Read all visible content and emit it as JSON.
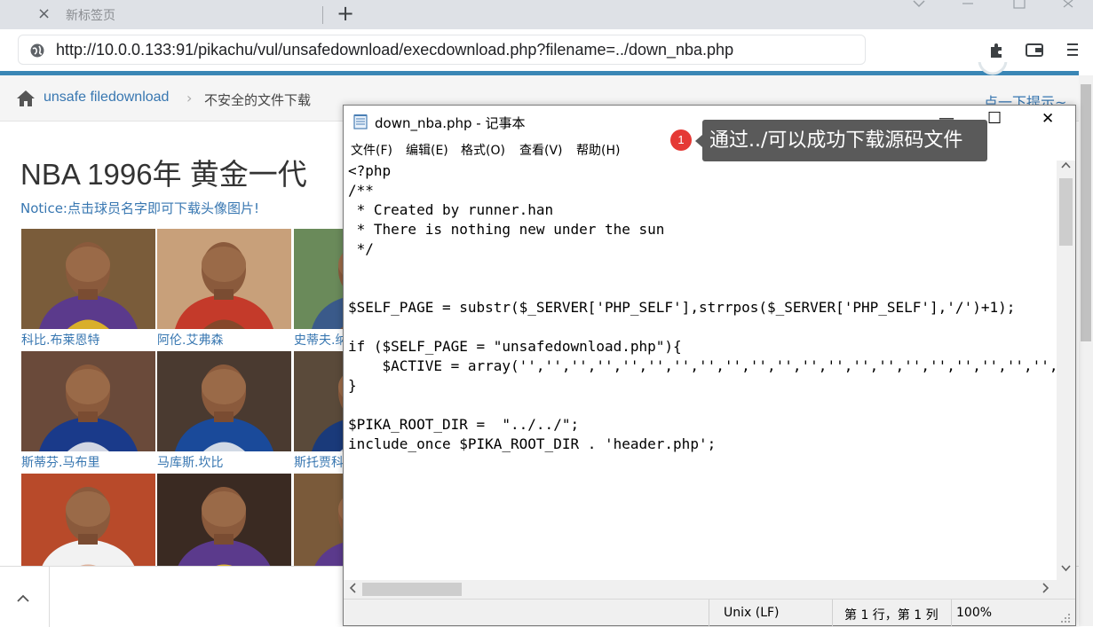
{
  "browser": {
    "tab_title": "新标签页",
    "tab_close": "×",
    "new_tab": "+",
    "url": "http://10.0.0.133:91/pikachu/vul/unsafedownload/execdownload.php?filename=../down_nba.php"
  },
  "page": {
    "breadcrumb_link": "unsafe filedownload",
    "breadcrumb_sep": "›",
    "breadcrumb_current": "不安全的文件下载",
    "hint": "点一下提示~",
    "heading": "NBA 1996年 黄金一代",
    "notice": "Notice:点击球员名字即可下载头像图片!",
    "players": [
      {
        "name": "科比.布莱恩特"
      },
      {
        "name": "阿伦.艾弗森"
      },
      {
        "name": "史蒂夫.纳什"
      },
      {
        "name": "斯蒂芬.马布里"
      },
      {
        "name": "马库斯.坎比"
      },
      {
        "name": "斯托贾科维奇"
      },
      {
        "name": ""
      },
      {
        "name": ""
      },
      {
        "name": ""
      }
    ],
    "scroll_up_label": "^"
  },
  "notepad": {
    "title": "down_nba.php - 记事本",
    "minimize": "—",
    "maximize": "☐",
    "close": "✕",
    "menu": [
      "文件(F)",
      "编辑(E)",
      "格式(O)",
      "查看(V)",
      "帮助(H)"
    ],
    "content": "<?php\n/**\n * Created by runner.han\n * There is nothing new under the sun\n */\n\n\n$SELF_PAGE = substr($_SERVER['PHP_SELF'],strrpos($_SERVER['PHP_SELF'],'/')+1);\n\nif ($SELF_PAGE = \"unsafedownload.php\"){\n    $ACTIVE = array('','','','','','','','','','','','','','','','','','','','','','\n}\n\n$PIKA_ROOT_DIR =  \"../../\";\ninclude_once $PIKA_ROOT_DIR . 'header.php';\n\n\n\n\n\n\n\n?>",
    "status": {
      "line_ending": "Unix (LF)",
      "position": "第 1 行，第 1 列",
      "zoom": "100%"
    }
  },
  "annotation": {
    "badge": "1",
    "callout": "通过../可以成功下载源码文件"
  },
  "colors": {
    "link": "#3877b1",
    "accent_line": "#3a86b5",
    "badge": "#e53935",
    "callout_bg": "#5a5a5a"
  }
}
